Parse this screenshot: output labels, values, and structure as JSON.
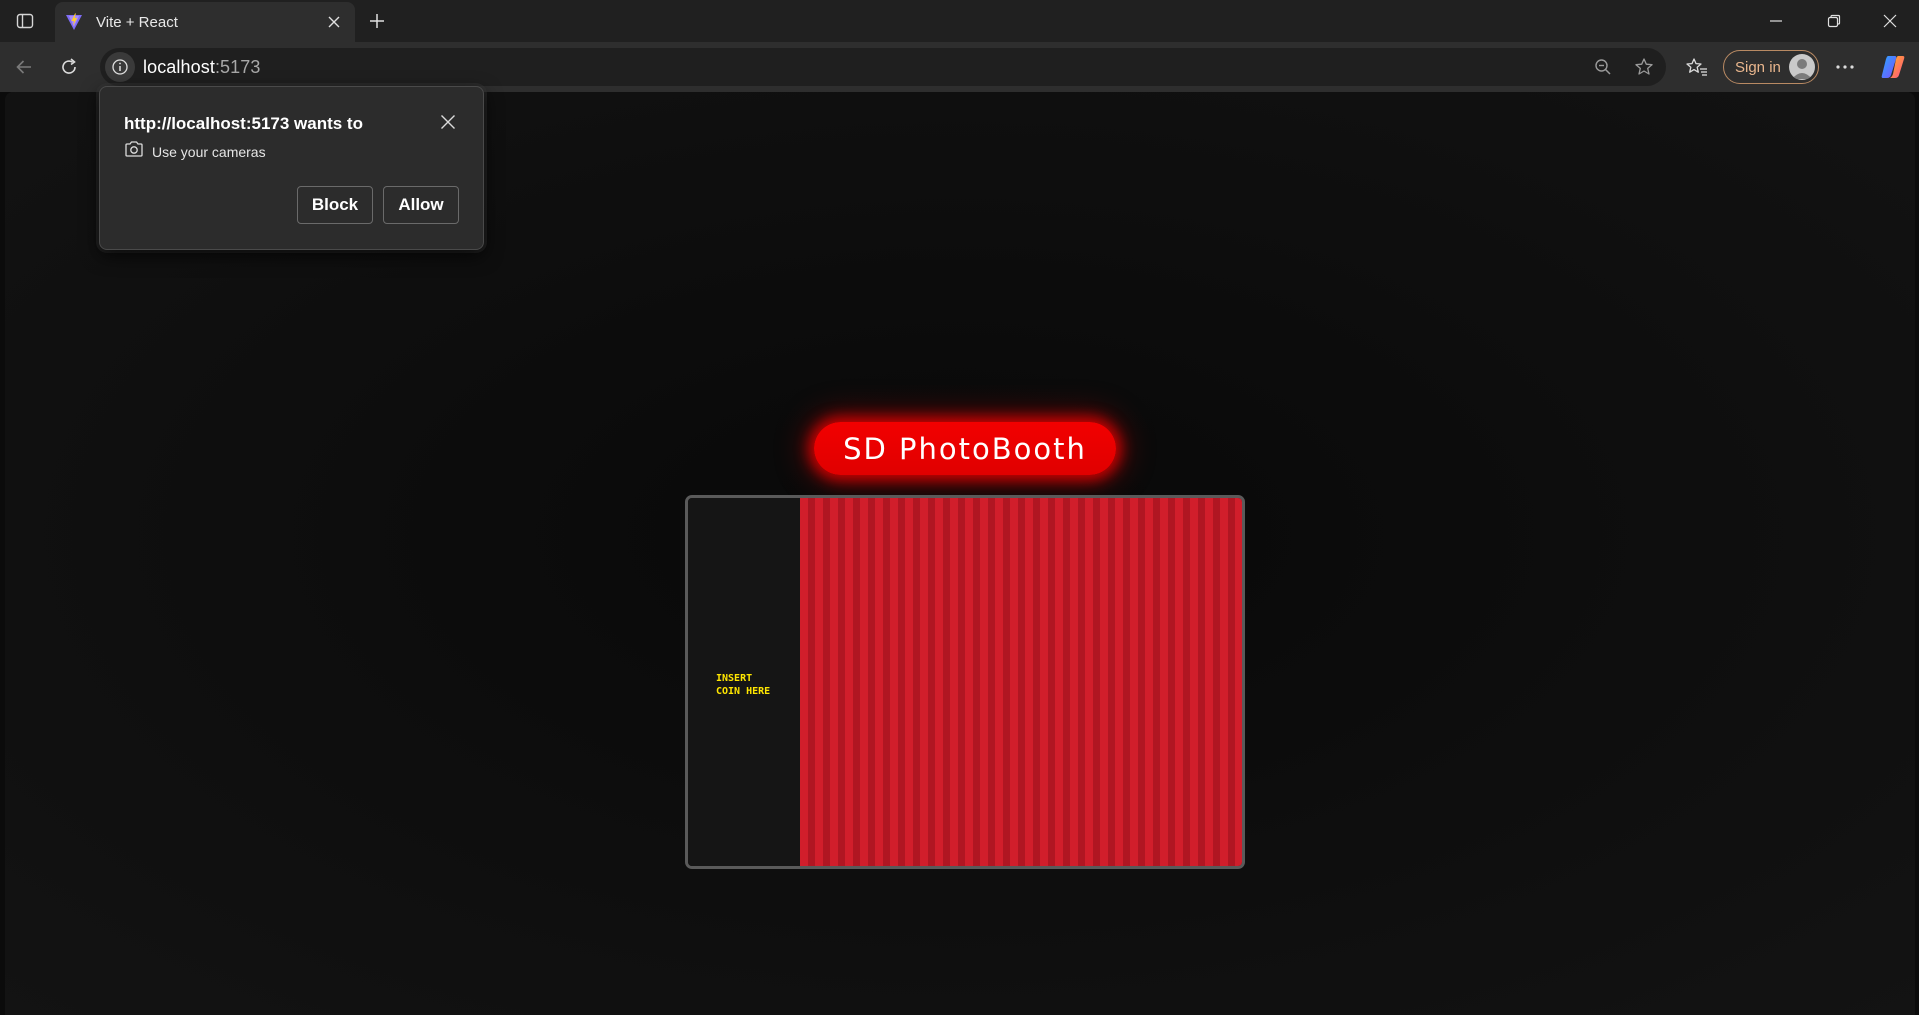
{
  "browser": {
    "tab": {
      "title": "Vite + React"
    },
    "address": {
      "host": "localhost",
      "port": ":5173"
    },
    "signin_label": "Sign in"
  },
  "permission_prompt": {
    "title": "http://localhost:5173 wants to",
    "request": "Use your cameras",
    "block_label": "Block",
    "allow_label": "Allow"
  },
  "app": {
    "title": "SD PhotoBooth",
    "coin_text": "INSERT\nCOIN HERE"
  },
  "icons": [
    "tab-actions-icon",
    "vite-favicon",
    "close-icon",
    "plus-icon",
    "minimize-icon",
    "restore-icon",
    "back-arrow-icon",
    "refresh-icon",
    "info-icon",
    "zoom-out-icon",
    "star-icon",
    "favorites-icon",
    "user-avatar-icon",
    "more-icon",
    "copilot-icon",
    "camera-icon"
  ],
  "colors": {
    "accent_red": "#ff0000",
    "curtain_red": "#d11e2b",
    "coin_yellow": "#ffe600",
    "signin_accent": "#e9b68d"
  }
}
